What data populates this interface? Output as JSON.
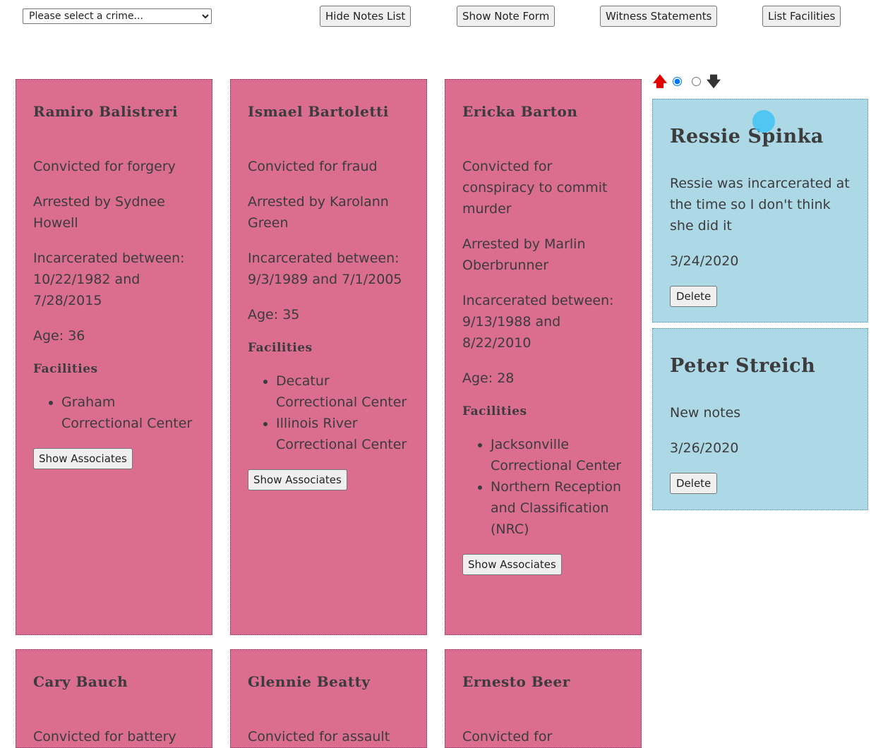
{
  "toolbar": {
    "crime_select": {
      "selected": "Please select a crime...",
      "options": [
        "Please select a crime..."
      ]
    },
    "hide_notes_label": "Hide Notes List",
    "show_note_form_label": "Show Note Form",
    "witness_statements_label": "Witness Statements",
    "list_facilities_label": "List Facilities"
  },
  "inmates": [
    {
      "name": "Ramiro Balistreri",
      "convicted": "Convicted for forgery",
      "arrested": "Arrested by Sydnee Howell",
      "incarcerated": "Incarcerated between: 10/22/1982 and 7/28/2015",
      "age": "Age: 36",
      "facilities_heading": "Facilities",
      "facilities": [
        "Graham Correctional Center"
      ],
      "button": "Show Associates"
    },
    {
      "name": "Ismael Bartoletti",
      "convicted": "Convicted for fraud",
      "arrested": "Arrested by Karolann Green",
      "incarcerated": "Incarcerated between: 9/3/1989 and 7/1/2005",
      "age": "Age: 35",
      "facilities_heading": "Facilities",
      "facilities": [
        "Decatur Correctional Center",
        "Illinois River Correctional Center"
      ],
      "button": "Show Associates"
    },
    {
      "name": "Ericka Barton",
      "convicted": "Convicted for conspiracy to commit murder",
      "arrested": "Arrested by Marlin Oberbrunner",
      "incarcerated": "Incarcerated between: 9/13/1988 and 8/22/2010",
      "age": "Age: 28",
      "facilities_heading": "Facilities",
      "facilities": [
        "Jacksonville Correctional Center",
        "Northern Reception and Classification (NRC)"
      ],
      "button": "Show Associates"
    },
    {
      "name": "Cary Bauch",
      "convicted": "Convicted for battery"
    },
    {
      "name": "Glennie Beatty",
      "convicted": "Convicted for assault"
    },
    {
      "name": "Ernesto Beer",
      "convicted": "Convicted for"
    }
  ],
  "sort": {
    "up_icon": "red-up-arrow",
    "down_icon": "black-down-arrow",
    "selected": "first"
  },
  "notes": [
    {
      "name": "Ressie Spinka",
      "text": "Ressie was incarcerated at the time so I don't think she did it",
      "date": "3/24/2020",
      "button": "Delete"
    },
    {
      "name": "Peter Streich",
      "text": "New notes",
      "date": "3/26/2020",
      "button": "Delete"
    }
  ],
  "colors": {
    "inmate_card": "#da6d90",
    "note_card": "#add8e6",
    "sort_up_arrow": "#e00000"
  }
}
